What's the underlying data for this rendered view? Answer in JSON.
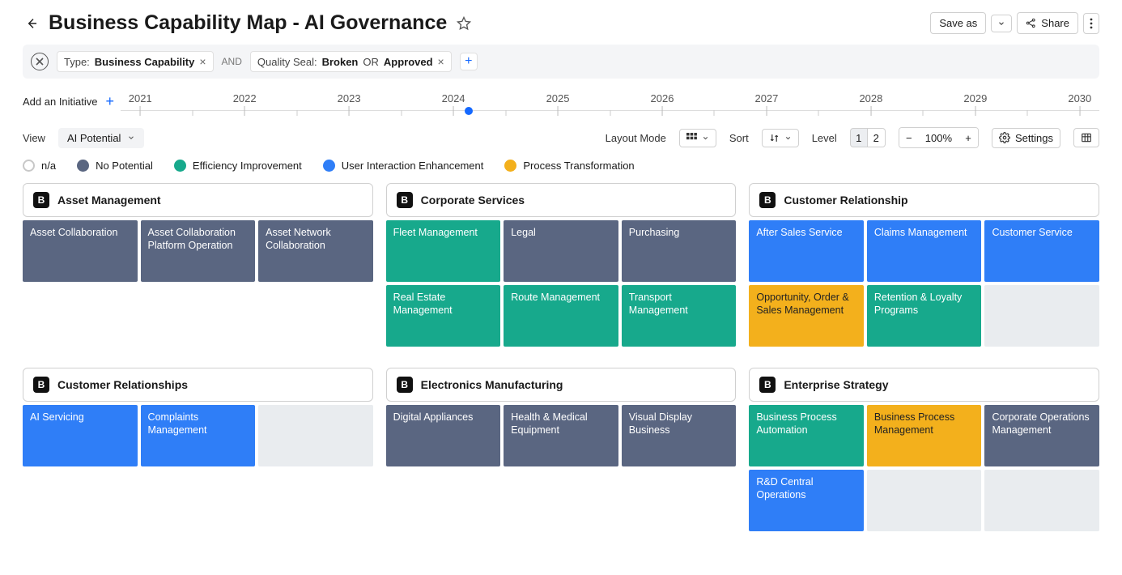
{
  "header": {
    "title": "Business Capability Map - AI Governance",
    "save_as": "Save as",
    "share": "Share"
  },
  "filters": {
    "chip1_key": "Type: ",
    "chip1_val": "Business Capability",
    "and": "AND",
    "chip2_key": "Quality Seal: ",
    "chip2_val": "Broken",
    "chip2_or": " OR ",
    "chip2_val2": "Approved"
  },
  "timeline": {
    "add_label": "Add an Initiative",
    "years": [
      "2021",
      "2022",
      "2023",
      "2024",
      "2025",
      "2026",
      "2027",
      "2028",
      "2029",
      "2030"
    ]
  },
  "toolbar": {
    "view_label": "View",
    "view_value": "AI Potential",
    "layout_label": "Layout Mode",
    "sort_label": "Sort",
    "level_label": "Level",
    "level_1": "1",
    "level_2": "2",
    "zoom_value": "100%",
    "settings": "Settings"
  },
  "legend": {
    "na": "n/a",
    "no": "No Potential",
    "eff": "Efficiency Improvement",
    "user": "User Interaction Enhancement",
    "proc": "Process Transformation"
  },
  "badge": "B",
  "row1": [
    {
      "title": "Asset Management",
      "rows": [
        [
          {
            "label": "Asset Collaboration",
            "cls": "no"
          },
          {
            "label": "Asset Collaboration Platform Operation",
            "cls": "no"
          },
          {
            "label": "Asset Network Collaboration",
            "cls": "no"
          }
        ]
      ]
    },
    {
      "title": "Corporate Services",
      "rows": [
        [
          {
            "label": "Fleet Management",
            "cls": "eff"
          },
          {
            "label": "Legal",
            "cls": "no"
          },
          {
            "label": "Purchasing",
            "cls": "no"
          }
        ],
        [
          {
            "label": "Real Estate Management",
            "cls": "eff"
          },
          {
            "label": "Route Management",
            "cls": "eff"
          },
          {
            "label": "Transport Management",
            "cls": "eff"
          }
        ]
      ]
    },
    {
      "title": "Customer Relationship",
      "rows": [
        [
          {
            "label": "After Sales Service",
            "cls": "user"
          },
          {
            "label": "Claims Management",
            "cls": "user"
          },
          {
            "label": "Customer Service",
            "cls": "user"
          }
        ],
        [
          {
            "label": "Opportunity, Order & Sales Management",
            "cls": "proc"
          },
          {
            "label": "Retention & Loyalty Programs",
            "cls": "eff"
          },
          {
            "label": "",
            "cls": "blank"
          }
        ]
      ]
    }
  ],
  "row2": [
    {
      "title": "Customer Relationships",
      "rows": [
        [
          {
            "label": "AI Servicing",
            "cls": "user"
          },
          {
            "label": "Complaints Management",
            "cls": "user"
          },
          {
            "label": "",
            "cls": "blank"
          }
        ]
      ]
    },
    {
      "title": "Electronics Manufacturing",
      "rows": [
        [
          {
            "label": "Digital Appliances",
            "cls": "no"
          },
          {
            "label": "Health & Medical Equipment",
            "cls": "no"
          },
          {
            "label": "Visual Display Business",
            "cls": "no"
          }
        ]
      ]
    },
    {
      "title": "Enterprise Strategy",
      "rows": [
        [
          {
            "label": "Business Process Automation",
            "cls": "eff"
          },
          {
            "label": "Business Process Management",
            "cls": "proc"
          },
          {
            "label": "Corporate Operations Management",
            "cls": "no"
          }
        ],
        [
          {
            "label": "R&D Central Operations",
            "cls": "user"
          },
          {
            "label": "",
            "cls": "blank"
          },
          {
            "label": "",
            "cls": "blank"
          }
        ]
      ]
    }
  ]
}
